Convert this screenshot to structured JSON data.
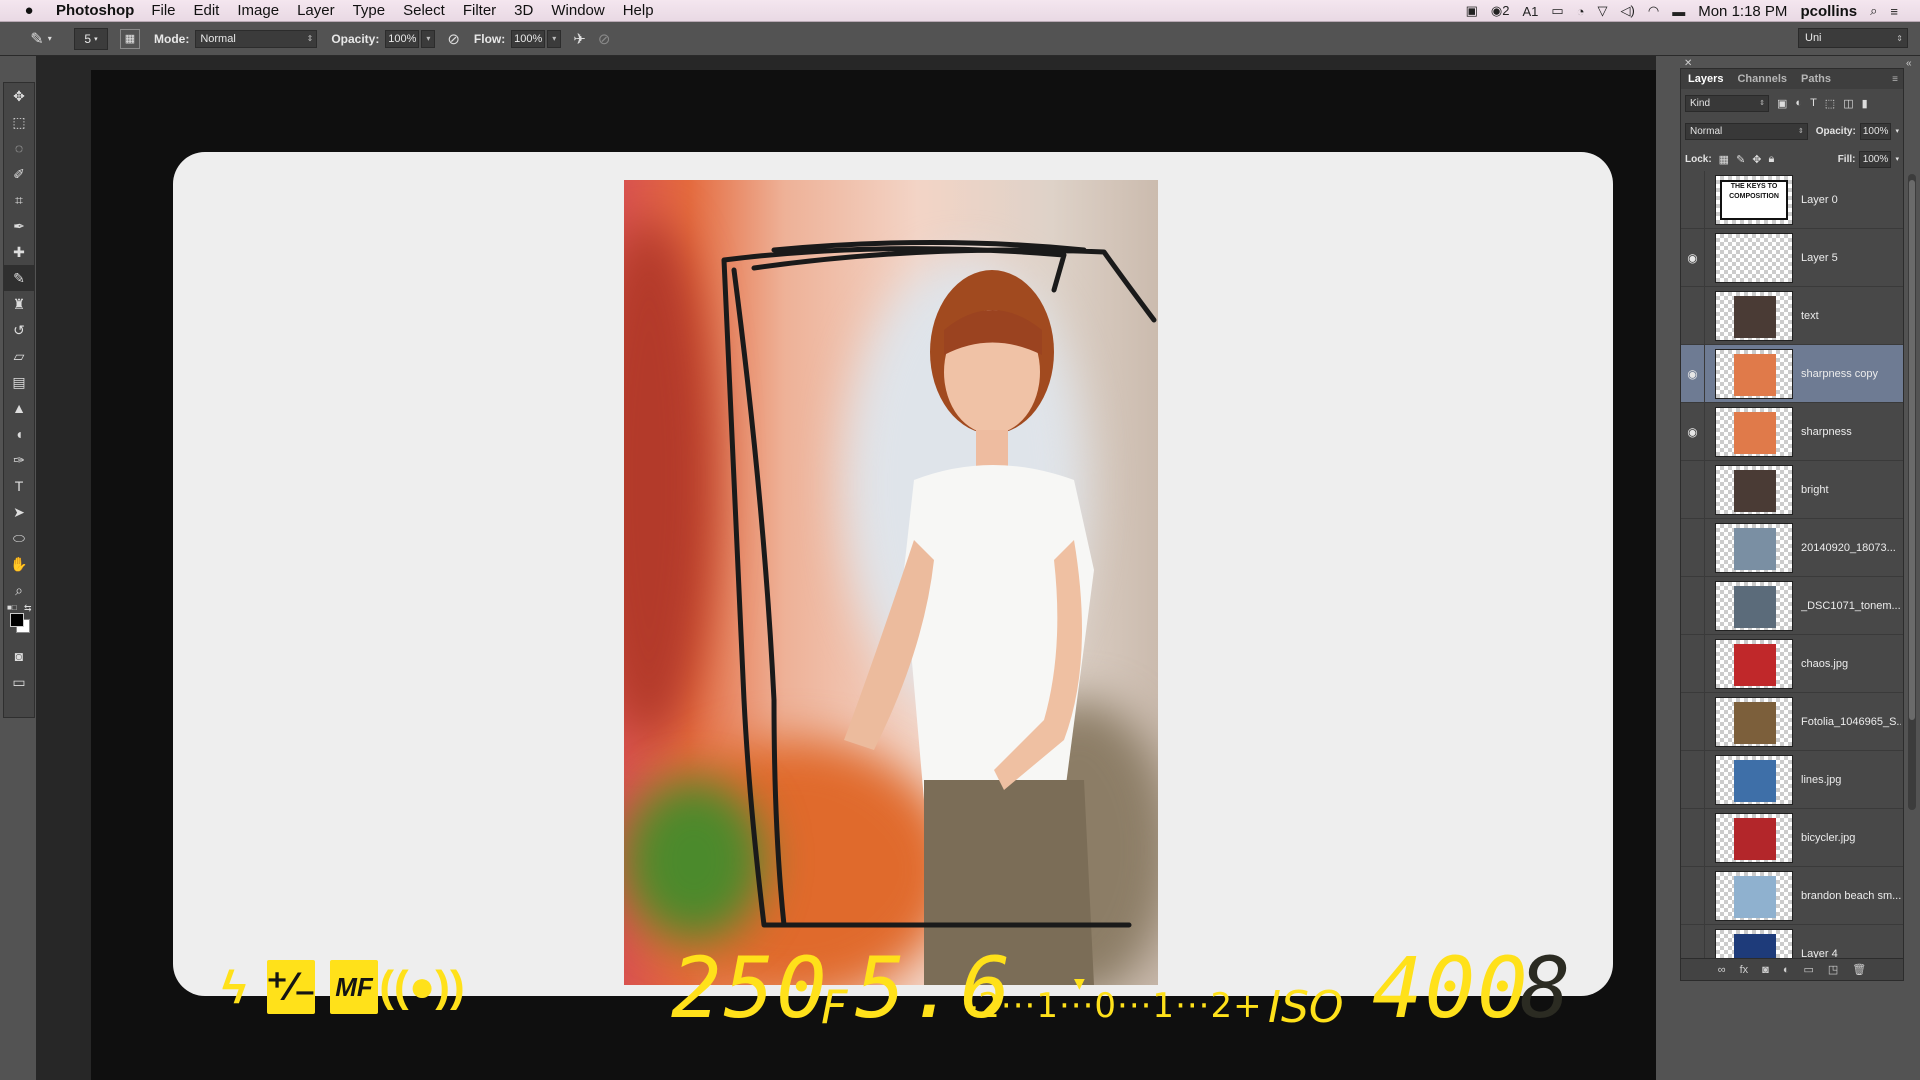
{
  "menubar": {
    "app_name": "Photoshop",
    "menus": [
      "File",
      "Edit",
      "Image",
      "Layer",
      "Type",
      "Select",
      "Filter",
      "3D",
      "Window",
      "Help"
    ],
    "status": {
      "badge1": "2",
      "badge2": "1",
      "clock": "Mon 1:18 PM",
      "user": "pcollins"
    }
  },
  "options": {
    "brush_size": "5",
    "mode_label": "Mode:",
    "mode_value": "Normal",
    "opacity_label": "Opacity:",
    "opacity_value": "100%",
    "flow_label": "Flow:",
    "flow_value": "100%",
    "workspace": "Uni"
  },
  "tools": [
    "move",
    "marquee",
    "lasso",
    "quick-select",
    "crop",
    "eyedropper",
    "healing",
    "brush",
    "stamp",
    "history-brush",
    "eraser",
    "gradient",
    "blur",
    "dodge",
    "pen",
    "type",
    "path-select",
    "shape",
    "hand",
    "zoom"
  ],
  "lcd": {
    "shutter": "250",
    "aperture_prefix": "F",
    "aperture": "5.6",
    "meter_scale": "-2···1···0···1···2+",
    "iso_prefix": "ISO",
    "iso": "400",
    "icons": {
      "flash": "flash-icon",
      "exposure_comp": "exposure-compensation-icon",
      "mf": "MF",
      "vr": "vibration-reduction-icon"
    },
    "color": "#ffe11a"
  },
  "layers_panel": {
    "tabs": [
      "Layers",
      "Channels",
      "Paths"
    ],
    "filter_kind": "Kind",
    "blend_mode": "Normal",
    "opacity_label": "Opacity:",
    "opacity": "100%",
    "lock_label": "Lock:",
    "fill_label": "Fill:",
    "fill": "100%",
    "keys_thumb_text": "THE KEYS TO COMPOSITION",
    "selection_color": "#6e7b93",
    "layers": [
      {
        "name": "Layer 0",
        "visible": false,
        "selected": false,
        "thumb": "keys-graphic"
      },
      {
        "name": "Layer 5",
        "visible": true,
        "selected": false,
        "thumb": "transparent"
      },
      {
        "name": "text",
        "visible": false,
        "selected": false,
        "thumb": "portrait-dark"
      },
      {
        "name": "sharpness copy",
        "visible": true,
        "selected": true,
        "thumb": "woman-kitchen"
      },
      {
        "name": "sharpness",
        "visible": true,
        "selected": false,
        "thumb": "woman-kitchen"
      },
      {
        "name": "bright",
        "visible": false,
        "selected": false,
        "thumb": "portrait-dark"
      },
      {
        "name": "20140920_18073...",
        "visible": false,
        "selected": false,
        "thumb": "landscape-cloudy"
      },
      {
        "name": "_DSC1071_tonem...",
        "visible": false,
        "selected": false,
        "thumb": "building"
      },
      {
        "name": "chaos.jpg",
        "visible": false,
        "selected": false,
        "thumb": "love-sculpture"
      },
      {
        "name": "Fotolia_1046965_S...",
        "visible": false,
        "selected": false,
        "thumb": "street"
      },
      {
        "name": "lines.jpg",
        "visible": false,
        "selected": false,
        "thumb": "lines-blue"
      },
      {
        "name": "bicycler.jpg",
        "visible": false,
        "selected": false,
        "thumb": "bicycle-red"
      },
      {
        "name": "brandon beach sm...",
        "visible": false,
        "selected": false,
        "thumb": "beach"
      },
      {
        "name": "Layer 4",
        "visible": false,
        "selected": false,
        "thumb": "crowd-blue"
      }
    ]
  }
}
